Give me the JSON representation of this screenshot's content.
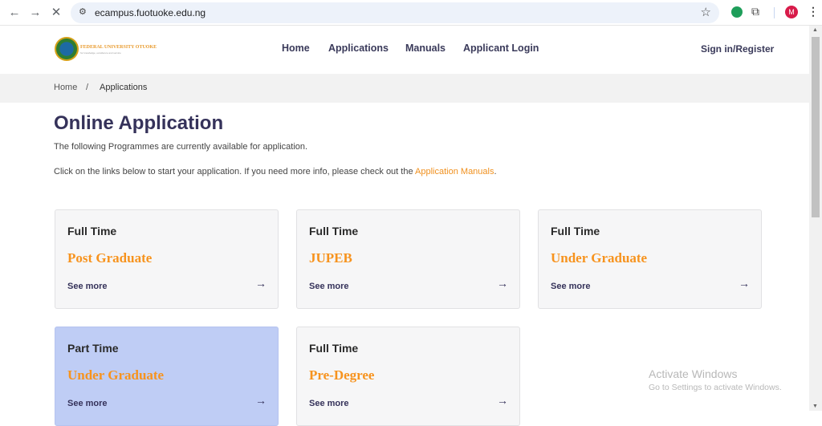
{
  "browser": {
    "url": "ecampus.fuotuoke.edu.ng",
    "back_icon": "←",
    "forward_icon": "→",
    "stop_icon": "✕",
    "site_settings_icon": "⚙",
    "bookmark_icon": "☆",
    "extensions_icon": "⧉",
    "profile_initial": "M",
    "menu_icon": "⋮"
  },
  "header": {
    "logo_text": "FEDERAL UNIVERSITY OTUOKE",
    "logo_tagline": "for knowledge, excellence and service",
    "nav": [
      "Home",
      "Applications",
      "Manuals",
      "Applicant Login"
    ],
    "signin": "Sign in/Register"
  },
  "breadcrumb": {
    "home": "Home",
    "separator": "/",
    "current": "Applications"
  },
  "main": {
    "title": "Online Application",
    "intro": "The following Programmes are currently available for application.",
    "instruction": "Click on the links below to start your application. If you need more info, please check out the ",
    "manuals_link": "Application Manuals",
    "instruction_end": ".",
    "cards": [
      {
        "mode": "Full Time",
        "programme": "Post Graduate",
        "link": "See more",
        "arrow": "→"
      },
      {
        "mode": "Full Time",
        "programme": "JUPEB",
        "link": "See more",
        "arrow": "→"
      },
      {
        "mode": "Full Time",
        "programme": "Under Graduate",
        "link": "See more",
        "arrow": "→"
      },
      {
        "mode": "Part Time",
        "programme": "Under Graduate",
        "link": "See more",
        "arrow": "→"
      },
      {
        "mode": "Full Time",
        "programme": "Pre-Degree",
        "link": "See more",
        "arrow": "→"
      }
    ]
  },
  "watermark": {
    "title": "Activate Windows",
    "subtitle": "Go to Settings to activate Windows."
  },
  "colors": {
    "accent": "#f7931e",
    "heading": "#35325a",
    "active_card": "#bfcdf5"
  }
}
